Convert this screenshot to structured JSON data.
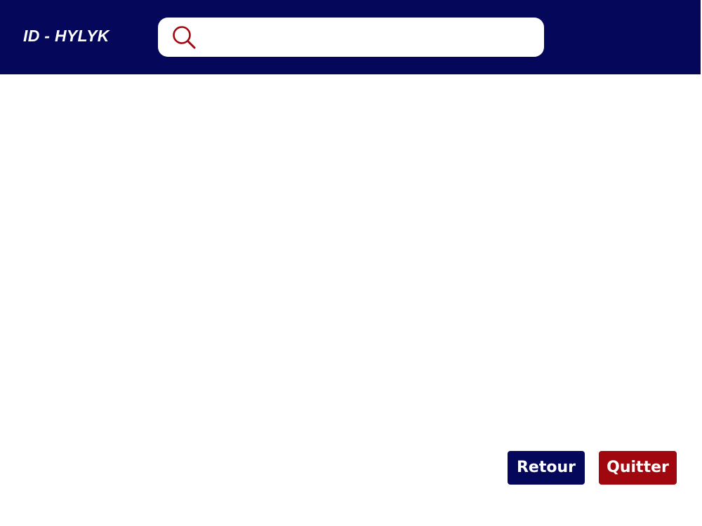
{
  "header": {
    "brand": "ID - HYLYK",
    "background_color": "#05075a"
  },
  "search": {
    "icon": "search-icon",
    "value": "",
    "placeholder": "",
    "icon_color": "#a1070e"
  },
  "footer": {
    "back_label": "Retour",
    "quit_label": "Quitter",
    "back_color": "#05075a",
    "quit_color": "#a1070e"
  }
}
